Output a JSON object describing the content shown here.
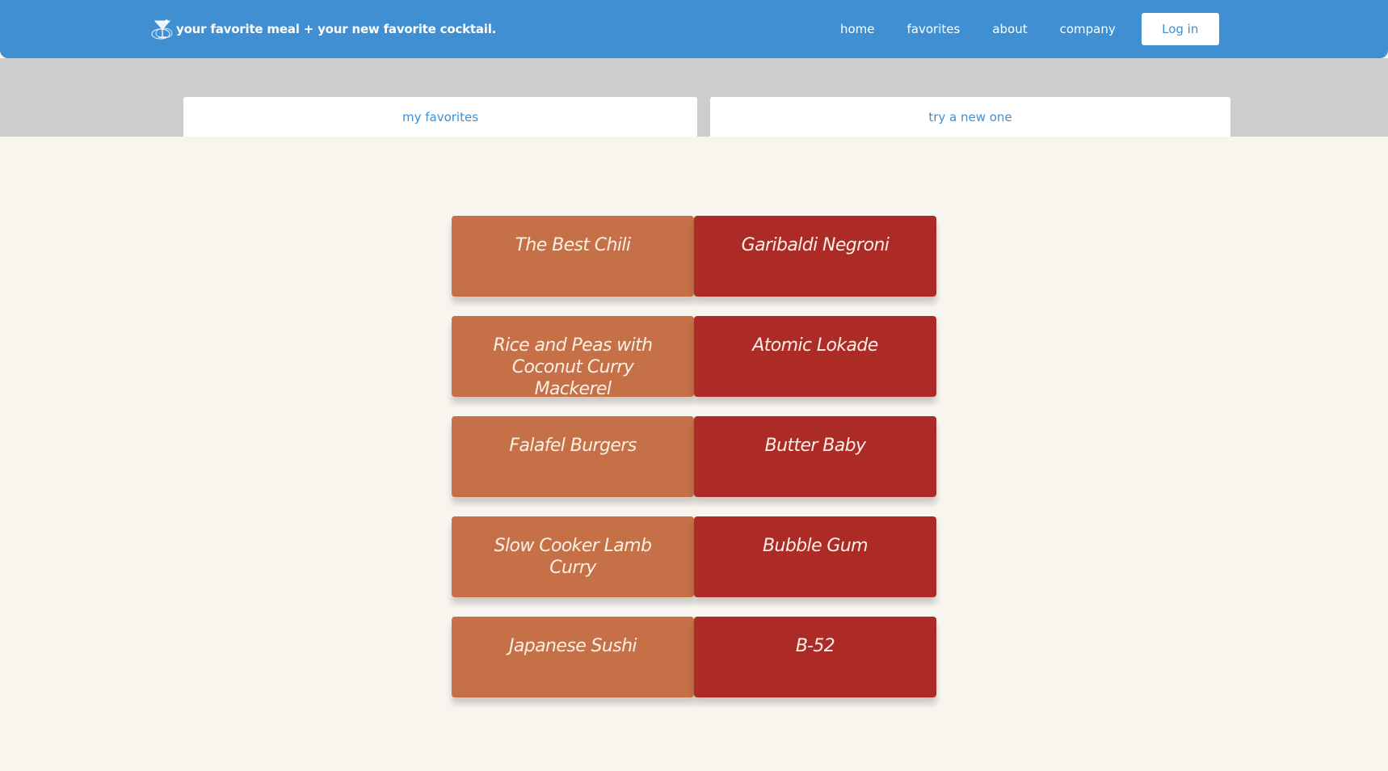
{
  "header": {
    "brand_text": "your favorite meal + your new favorite cocktail.",
    "brand_icon": "cocktail-glass-icon",
    "nav": [
      "home",
      "favorites",
      "about",
      "company"
    ],
    "login_label": "Log in"
  },
  "tabs": {
    "favorites": "my favorites",
    "try_new": "try a new one"
  },
  "pairs": [
    {
      "meal": "The Best Chili",
      "cocktail": "Garibaldi Negroni"
    },
    {
      "meal": "Rice and Peas with Coconut Curry Mackerel",
      "cocktail": "Atomic Lokade"
    },
    {
      "meal": "Falafel Burgers",
      "cocktail": "Butter Baby"
    },
    {
      "meal": "Slow Cooker Lamb Curry",
      "cocktail": "Bubble Gum"
    },
    {
      "meal": "Japanese Sushi",
      "cocktail": "B-52"
    }
  ],
  "colors": {
    "header": "#3f8fd2",
    "tab_band": "#cdcdcd",
    "page_bg": "#f8f5ef",
    "meal_card": "#c57047",
    "cocktail_card": "#ad2b26"
  }
}
